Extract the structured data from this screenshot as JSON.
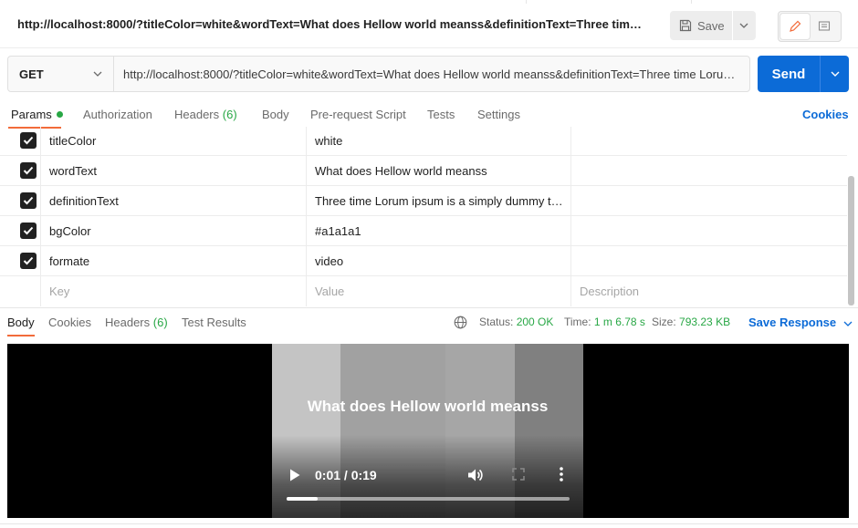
{
  "window": {
    "url_title": "http://localhost:8000/?titleColor=white&wordText=What does Hellow world meanss&definitionText=Three time Lor...",
    "save_label": "Save"
  },
  "request": {
    "method": "GET",
    "url": "http://localhost:8000/?titleColor=white&wordText=What does Hellow world meanss&definitionText=Three time  Lorum ipsum",
    "send_label": "Send"
  },
  "request_tabs": {
    "params": "Params",
    "authorization": "Authorization",
    "headers": "Headers",
    "headers_count": "(6)",
    "body": "Body",
    "pre_request": "Pre-request Script",
    "tests": "Tests",
    "settings": "Settings",
    "cookies": "Cookies"
  },
  "params": {
    "rows": [
      {
        "key": "titleColor",
        "value": "white",
        "checked": true
      },
      {
        "key": "wordText",
        "value": "What does Hellow world meanss",
        "checked": true
      },
      {
        "key": "definitionText",
        "value": "Three time  Lorum ipsum is a simply dummy te...",
        "checked": true
      },
      {
        "key": "bgColor",
        "value": "#a1a1a1",
        "checked": true
      },
      {
        "key": "formate",
        "value": "video",
        "checked": true
      }
    ],
    "placeholder": {
      "key": "Key",
      "value": "Value",
      "description": "Description"
    }
  },
  "response": {
    "tabs": {
      "body": "Body",
      "cookies": "Cookies",
      "headers": "Headers",
      "headers_count": "(6)",
      "test_results": "Test Results"
    },
    "status_label": "Status:",
    "status_value": "200 OK",
    "time_label": "Time:",
    "time_value": "1 m 6.78 s",
    "size_label": "Size:",
    "size_value": "793.23 KB",
    "save_response": "Save Response"
  },
  "video": {
    "title": "What does Hellow world meanss",
    "time": "0:01 / 0:19",
    "progress_fraction": 0.11,
    "band_colors": [
      "#c4c4c4",
      "#a1a1a1",
      "#a6a6a6",
      "#808080"
    ]
  },
  "colors": {
    "accent_orange": "#f26b3a",
    "primary_blue": "#0c6bd7",
    "success_green": "#28a745"
  }
}
